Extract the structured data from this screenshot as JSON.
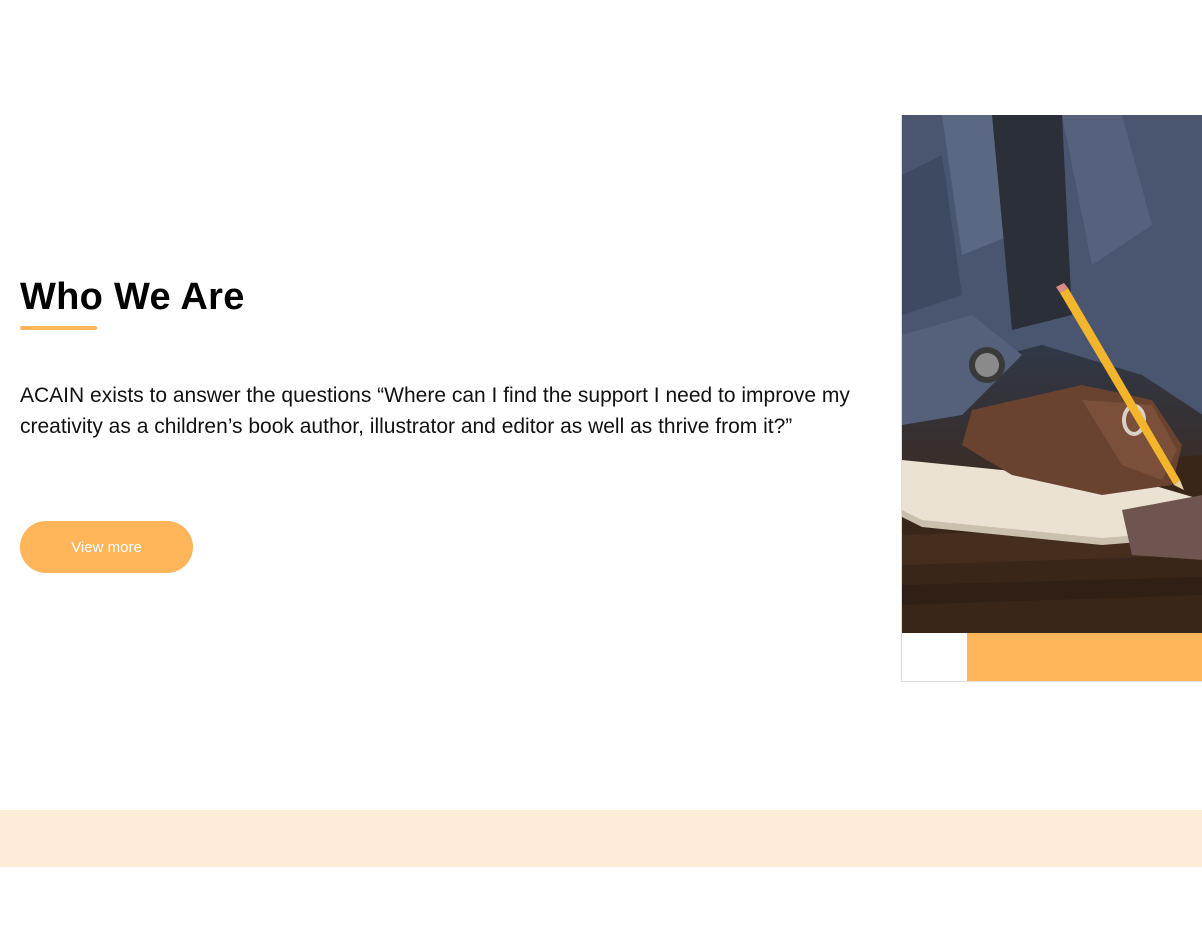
{
  "about": {
    "title": "Who We Are",
    "description": "ACAIN exists to answer the questions “Where can I find the support I need to improve my creativity as a children’s book author, illustrator and editor as well as thrive from it?”",
    "button_label": "View more"
  },
  "colors": {
    "accent": "#ffb55a",
    "band": "#ffecd6",
    "text": "#111111"
  },
  "image": {
    "subject": "person-writing-with-pencil-photo"
  }
}
